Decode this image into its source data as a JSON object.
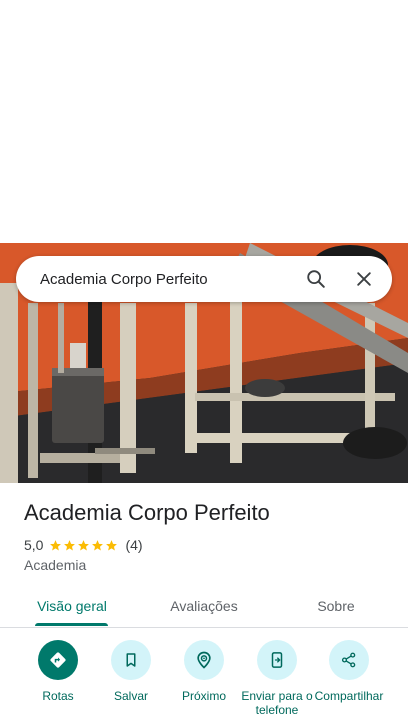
{
  "search": {
    "query": "Academia Corpo Perfeito"
  },
  "place": {
    "name": "Academia Corpo Perfeito",
    "rating": "5,0",
    "stars": 5,
    "review_count": "(4)",
    "category": "Academia"
  },
  "tabs": [
    {
      "label": "Visão geral",
      "active": true
    },
    {
      "label": "Avaliações",
      "active": false
    },
    {
      "label": "Sobre",
      "active": false
    }
  ],
  "actions": [
    {
      "label": "Rotas",
      "icon": "directions-icon"
    },
    {
      "label": "Salvar",
      "icon": "bookmark-icon"
    },
    {
      "label": "Próximo",
      "icon": "nearby-icon"
    },
    {
      "label": "Enviar para o telefone",
      "icon": "send-to-phone-icon"
    },
    {
      "label": "Compartilhar",
      "icon": "share-icon"
    }
  ],
  "colors": {
    "accent": "#00796b",
    "action_bg": "#d3f4f9",
    "star": "#fbbc04",
    "wall": "#d8582a"
  }
}
